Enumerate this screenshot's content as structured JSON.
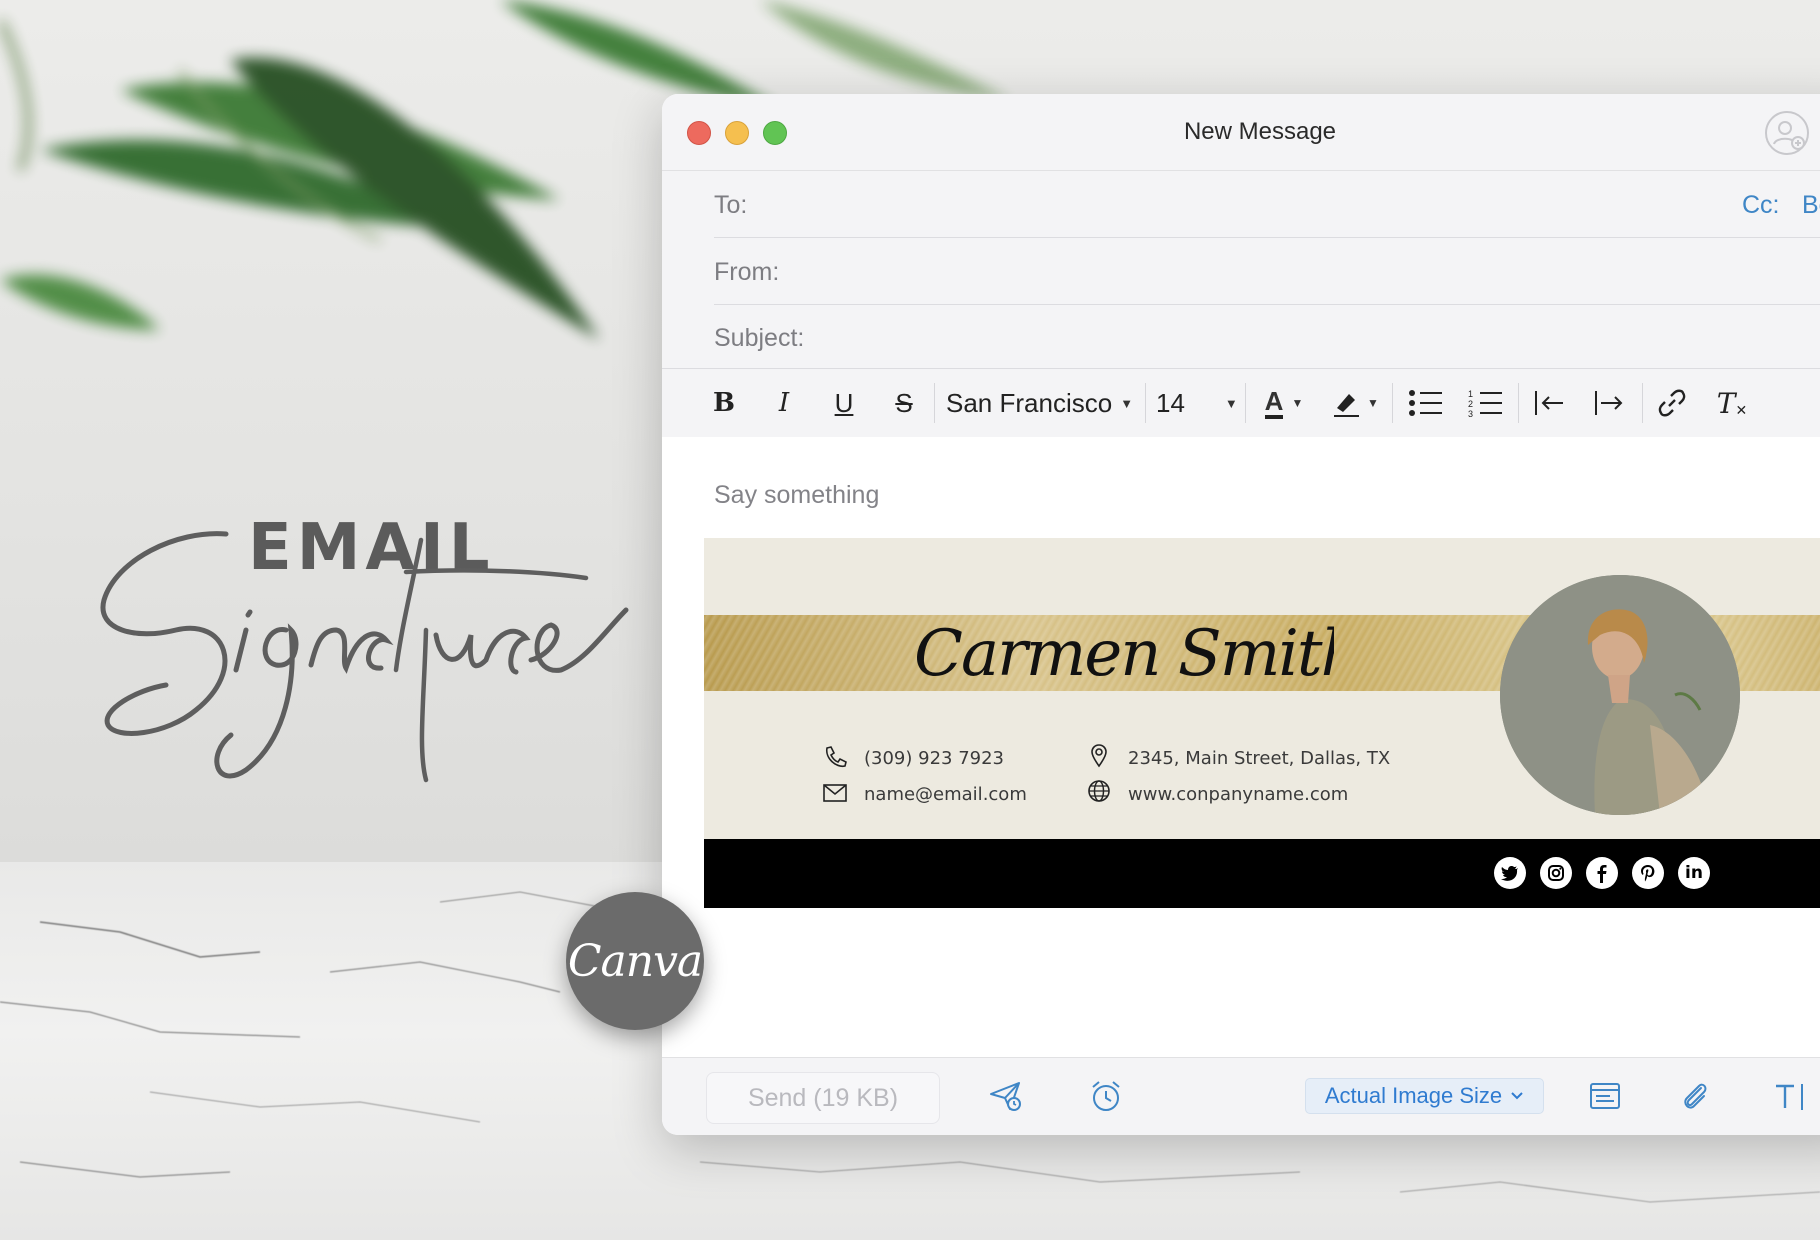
{
  "hero": {
    "title_top": "EMAIL",
    "title_script": "Signature",
    "badge": "Canva"
  },
  "window": {
    "title": "New Message",
    "fields": {
      "to_label": "To:",
      "from_label": "From:",
      "subject_label": "Subject:",
      "cc_label": "Cc:",
      "bcc_label": "Bcc:"
    },
    "toolbar": {
      "bold": "B",
      "italic": "I",
      "underline": "U",
      "strike": "S",
      "font": "San Francisco",
      "size": "14",
      "text_color_letter": "A",
      "clear_format": "T"
    },
    "body": {
      "placeholder": "Say something"
    },
    "signature": {
      "name": "Carmen Smith",
      "phone": "(309) 923 7923",
      "email": "name@email.com",
      "address": "2345, Main Street, Dallas, TX",
      "website": "www.conpanyname.com",
      "social": [
        "twitter-icon",
        "instagram-icon",
        "facebook-icon",
        "pinterest-icon",
        "linkedin-icon"
      ],
      "linkedin_text": "in"
    },
    "footer": {
      "send": "Send (19 KB)",
      "image_size": "Actual Image Size"
    }
  },
  "colors": {
    "accent_blue": "#3f86c6",
    "gold": "#c7ab5f",
    "banner_bg": "#edeae0"
  }
}
